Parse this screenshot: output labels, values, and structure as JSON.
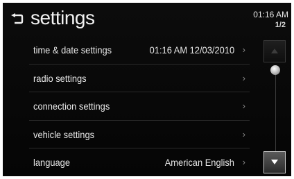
{
  "header": {
    "title": "settings",
    "clock": "01:16 AM",
    "page_indicator": "1/2",
    "back_icon": "back-arrow-icon"
  },
  "settings_list": {
    "items": [
      {
        "label": "time & date settings",
        "value": "01:16 AM   12/03/2010",
        "chevron": "›"
      },
      {
        "label": "radio settings",
        "value": "",
        "chevron": "›"
      },
      {
        "label": "connection settings",
        "value": "",
        "chevron": "›"
      },
      {
        "label": "vehicle settings",
        "value": "",
        "chevron": "›"
      },
      {
        "label": "language",
        "value": "American English",
        "chevron": "›"
      }
    ]
  },
  "scrollbar": {
    "up_icon": "triangle-up-icon",
    "down_icon": "triangle-down-icon",
    "position": 0.0
  },
  "colors": {
    "background": "#0a0a0a",
    "text": "#e8e8e8",
    "divider": "#2a2a2a"
  }
}
